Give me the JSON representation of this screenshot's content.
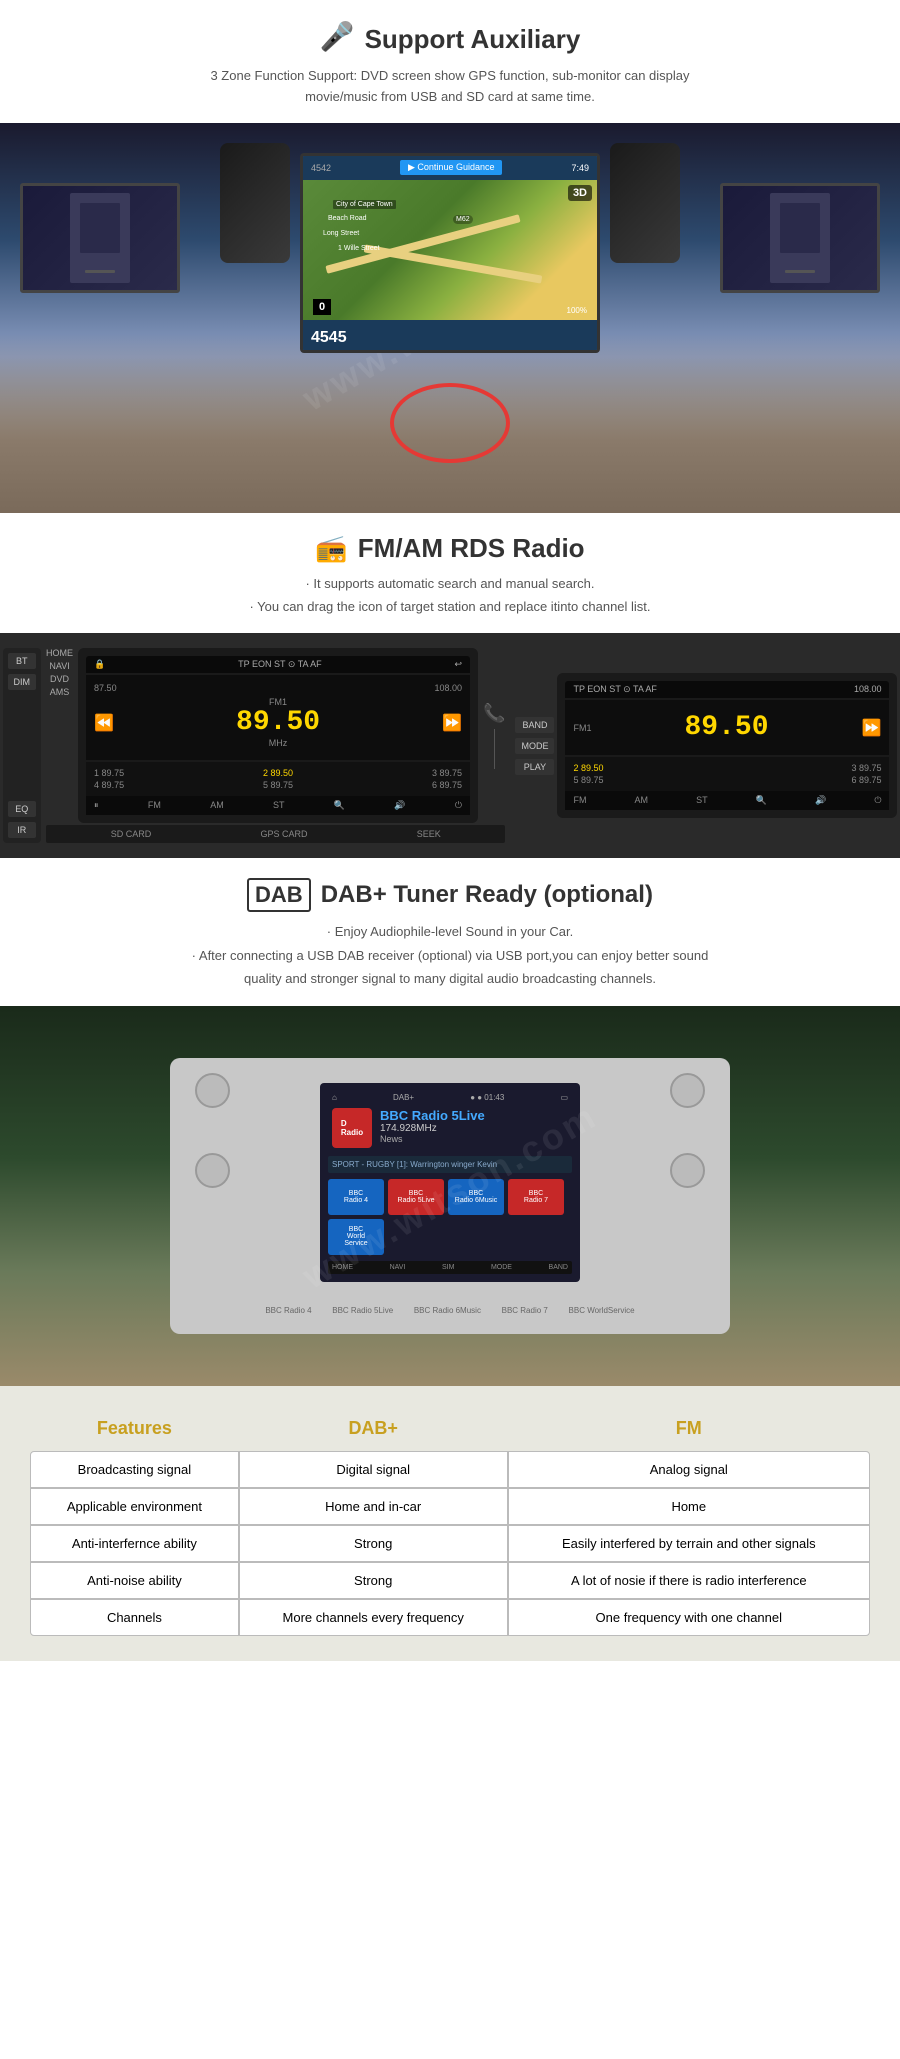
{
  "auxiliary": {
    "icon": "🎤",
    "title": "Support Auxiliary",
    "description": "3 Zone Function Support: DVD screen show GPS function, sub-monitor can display\nmovie/music from USB and SD card at same time."
  },
  "radio": {
    "icon": "📻",
    "title": "FM/AM RDS Radio",
    "feature1": "· It supports automatic search and manual search.",
    "feature2": "· You can drag the icon of target station and replace itinto channel list.",
    "freq_left": "89.50",
    "freq_right": "89.50",
    "label_fm": "FM",
    "label_am": "AM",
    "label_st": "ST",
    "freq_start": "87.50",
    "freq_end": "108.00",
    "freq_mhz": "MHz",
    "preset1": "89.75",
    "preset2": "89.50",
    "preset3": "89.75",
    "preset4": "89.75",
    "preset5": "89.75",
    "preset6": "89.75",
    "band_btn": "BAND",
    "mode_btn": "MODE",
    "play_btn": "PLAY",
    "sd_card": "SD CARD",
    "gps_card": "GPS CARD",
    "seek": "SEEK"
  },
  "dab": {
    "logo": "DAB",
    "title": "DAB+ Tuner Ready (optional)",
    "feature1": "· Enjoy Audiophile-level Sound in your Car.",
    "feature2": "· After connecting a USB DAB receiver (optional) via USB port,you can enjoy better sound\nquality and stronger signal to many digital audio broadcasting channels.",
    "station": "BBC Radio 5Live",
    "freq": "174.928MHz",
    "category": "News",
    "sport_ticker": "SPORT - RUGBY [1]: Warrington winger Kevin",
    "ch1": "BBC\nRadio 4",
    "ch2": "BBC\nRadio 5Live",
    "ch3": "BBC\nRadio 6Music",
    "ch4": "BBC\nRadio 7",
    "ch5": "BBC\nWorld\nService"
  },
  "comparison": {
    "header_features": "Features",
    "header_dab": "DAB+",
    "header_fm": "FM",
    "rows": [
      {
        "feature": "Broadcasting signal",
        "dab": "Digital signal",
        "fm": "Analog signal"
      },
      {
        "feature": "Applicable environment",
        "dab": "Home and in-car",
        "fm": "Home"
      },
      {
        "feature": "Anti-interfernce ability",
        "dab": "Strong",
        "fm": "Easily interfered by terrain and other signals"
      },
      {
        "feature": "Anti-noise ability",
        "dab": "Strong",
        "fm": "A lot of nosie if there is radio interference"
      },
      {
        "feature": "Channels",
        "dab": "More channels every frequency",
        "fm": "One frequency with one channel"
      }
    ]
  }
}
